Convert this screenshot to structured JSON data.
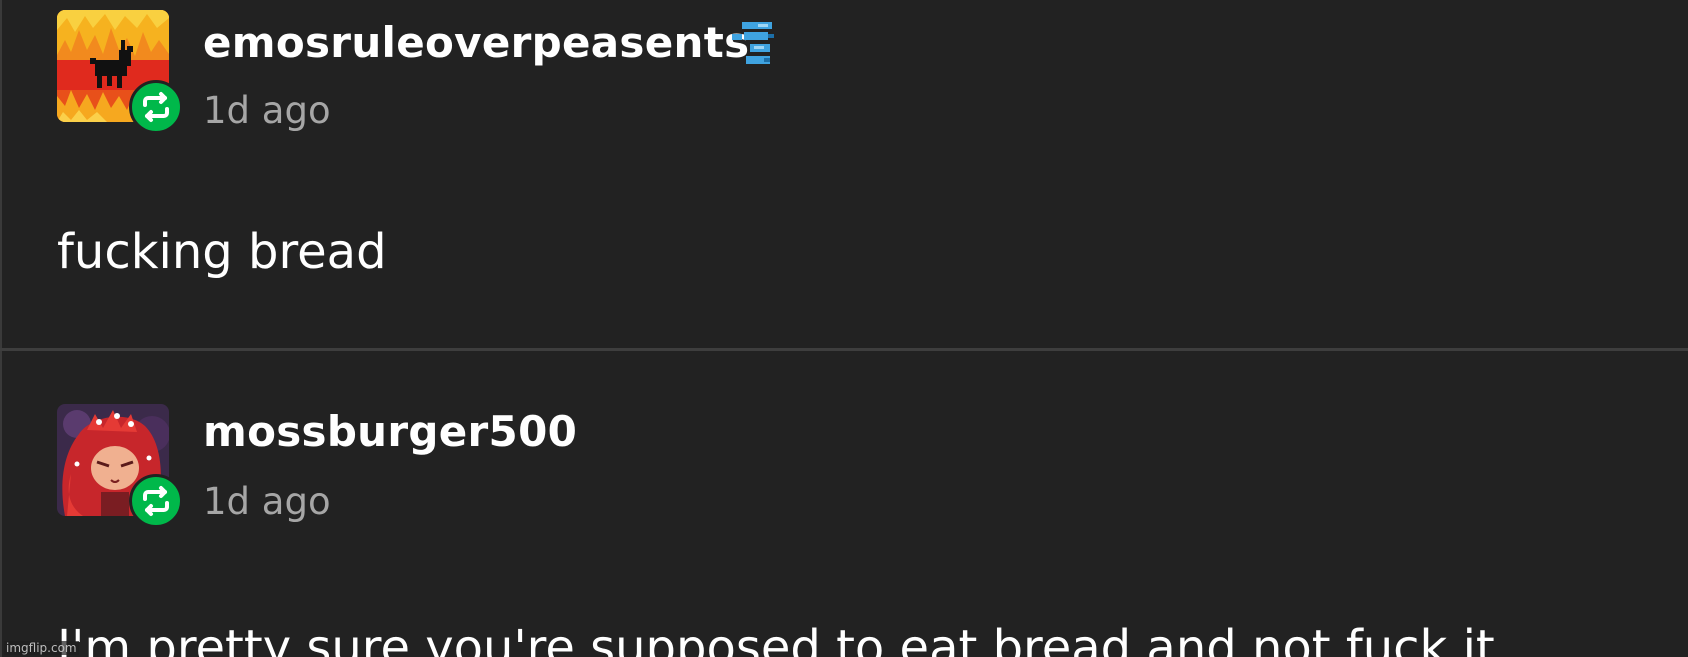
{
  "posts": [
    {
      "username": "emosruleoverpeasents",
      "timestamp": "1d ago",
      "body": "fucking bread",
      "avatar_icon": "flaming-goat-avatar",
      "has_badge": true,
      "badge_icon": "blue-pixel-badge-icon",
      "reblog_icon": "reblog-icon"
    },
    {
      "username": "mossburger500",
      "timestamp": "1d ago",
      "body": "I'm pretty sure you're supposed to eat bread and not fuck it",
      "avatar_icon": "red-haired-character-avatar",
      "has_badge": false,
      "reblog_icon": "reblog-icon"
    }
  ],
  "watermark": "imgflip.com",
  "colors": {
    "background": "#222222",
    "divider": "#3e3e3e",
    "reblog_green": "#00b84a",
    "username": "#ffffff",
    "timestamp": "#a6a6a6",
    "body_text": "#ffffff"
  }
}
